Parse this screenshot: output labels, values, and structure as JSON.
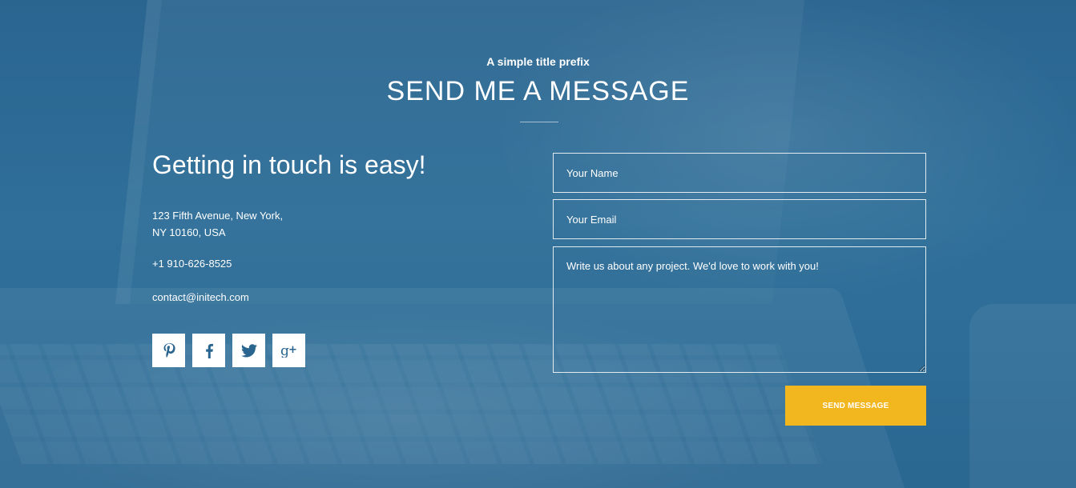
{
  "header": {
    "prefix": "A simple title prefix",
    "title": "SEND ME A MESSAGE"
  },
  "contact": {
    "heading": "Getting in touch is easy!",
    "address_line1": "123 Fifth Avenue, New York,",
    "address_line2": "NY 10160, USA",
    "phone": "+1 910-626-8525",
    "email": "contact@initech.com"
  },
  "socials": [
    {
      "icon": "pinterest-icon",
      "glyph": "P"
    },
    {
      "icon": "facebook-icon",
      "glyph": "f"
    },
    {
      "icon": "twitter-icon",
      "glyph": "bird"
    },
    {
      "icon": "google-plus-icon",
      "glyph": "g+"
    }
  ],
  "form": {
    "name_placeholder": "Your Name",
    "email_placeholder": "Your Email",
    "message_placeholder": "Write us about any project. We'd love to work with you!",
    "send_label": "SEND MESSAGE"
  },
  "colors": {
    "background": "#2c6a94",
    "icon": "#2a6590",
    "button": "#f2b61f"
  }
}
